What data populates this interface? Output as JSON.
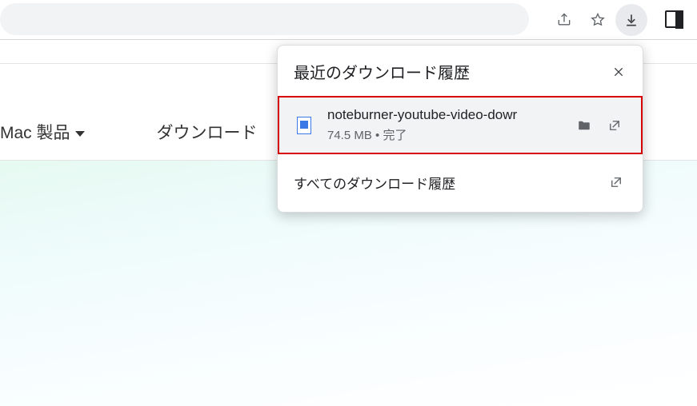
{
  "nav": {
    "mac_label": "Mac 製品",
    "downloads_label": "ダウンロード"
  },
  "popup": {
    "title": "最近のダウンロード履歴",
    "item": {
      "filename": "noteburner-youtube-video-dowr",
      "subtext": "74.5 MB • 完了"
    },
    "footer_label": "すべてのダウンロード履歴"
  }
}
